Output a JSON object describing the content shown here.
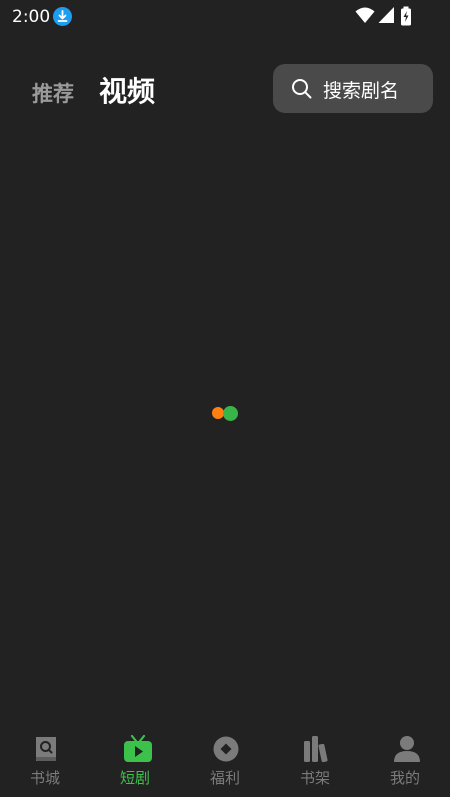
{
  "status_bar": {
    "time": "2:00",
    "icons": [
      "download-icon",
      "wifi-icon",
      "cellular-signal-icon",
      "battery-charging-icon"
    ]
  },
  "top_tabs": [
    {
      "label": "推荐",
      "active": false
    },
    {
      "label": "视频",
      "active": true
    }
  ],
  "search": {
    "placeholder": "搜索剧名",
    "icon": "search-icon"
  },
  "bottom_nav": [
    {
      "label": "书城",
      "icon": "bookstore-icon",
      "active": false
    },
    {
      "label": "短剧",
      "icon": "tv-play-icon",
      "active": true
    },
    {
      "label": "福利",
      "icon": "coin-icon",
      "active": false
    },
    {
      "label": "书架",
      "icon": "bookshelf-icon",
      "active": false
    },
    {
      "label": "我的",
      "icon": "profile-icon",
      "active": false
    }
  ],
  "colors": {
    "background": "#222222",
    "accent_green": "#3cc24a",
    "loader_orange": "#ff7f13",
    "loader_green": "#38b549",
    "inactive": "#7b7b7b",
    "download_badge": "#1e9cf0"
  }
}
